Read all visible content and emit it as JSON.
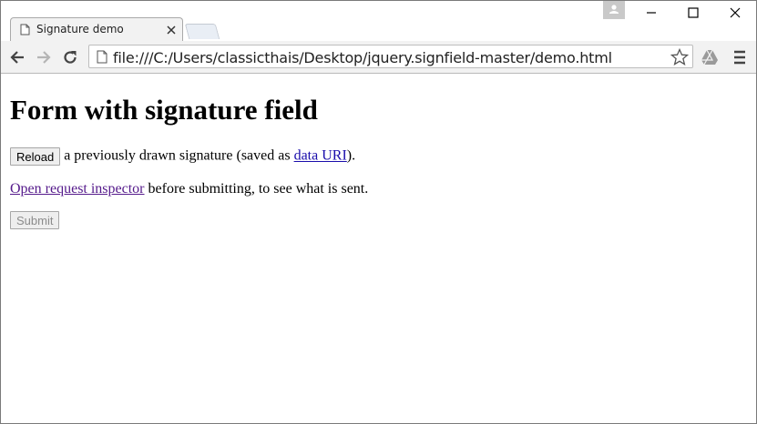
{
  "browser": {
    "tab": {
      "title": "Signature demo"
    },
    "address_bar": {
      "url": "file:///C:/Users/classicthais/Desktop/jquery.signfield-master/demo.html"
    },
    "colors": {
      "link": "#1a0dab",
      "visited_link": "#551a8b",
      "toolbar": "#f2f2f2"
    }
  },
  "page": {
    "heading": "Form with signature field",
    "reload_button": "Reload",
    "reload_text_before_link": " a previously drawn signature (saved as ",
    "data_uri_link": "data URI",
    "reload_text_after_link": ").",
    "inspector_link": "Open request inspector",
    "inspector_text": " before submitting, to see what is sent.",
    "submit_button": "Submit"
  }
}
